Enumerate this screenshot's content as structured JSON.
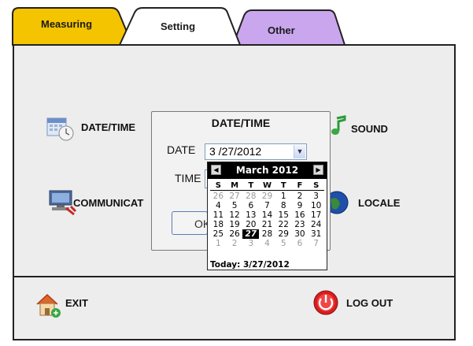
{
  "tabs": [
    {
      "label": "Measuring",
      "color": "#f4c400"
    },
    {
      "label": "Setting",
      "color": "#ffffff"
    },
    {
      "label": "Other",
      "color": "#c9a6ee"
    }
  ],
  "menu": {
    "date_time": "DATE/TIME",
    "sound": "SOUND",
    "communication": "COMMUNICAT",
    "locale": "LOCALE"
  },
  "footer": {
    "exit": "EXIT",
    "logout": "LOG OUT"
  },
  "dialog": {
    "title": "DATE/TIME",
    "date_label": "DATE",
    "date_value": "3 /27/2012",
    "time_label": "TIME",
    "ok_label": "OK"
  },
  "calendar": {
    "month": "March 2012",
    "weekdays": [
      "S",
      "M",
      "T",
      "W",
      "T",
      "F",
      "S"
    ],
    "weeks": [
      [
        {
          "d": "26",
          "m": true
        },
        {
          "d": "27",
          "m": true
        },
        {
          "d": "28",
          "m": true
        },
        {
          "d": "29",
          "m": true
        },
        {
          "d": "1"
        },
        {
          "d": "2"
        },
        {
          "d": "3"
        }
      ],
      [
        {
          "d": "4"
        },
        {
          "d": "5"
        },
        {
          "d": "6"
        },
        {
          "d": "7"
        },
        {
          "d": "8"
        },
        {
          "d": "9"
        },
        {
          "d": "10"
        }
      ],
      [
        {
          "d": "11"
        },
        {
          "d": "12"
        },
        {
          "d": "13"
        },
        {
          "d": "14"
        },
        {
          "d": "15"
        },
        {
          "d": "16"
        },
        {
          "d": "17"
        }
      ],
      [
        {
          "d": "18"
        },
        {
          "d": "19"
        },
        {
          "d": "20"
        },
        {
          "d": "21"
        },
        {
          "d": "22"
        },
        {
          "d": "23"
        },
        {
          "d": "24"
        }
      ],
      [
        {
          "d": "25"
        },
        {
          "d": "26"
        },
        {
          "d": "27",
          "s": true
        },
        {
          "d": "28"
        },
        {
          "d": "29"
        },
        {
          "d": "30"
        },
        {
          "d": "31"
        }
      ],
      [
        {
          "d": "1",
          "m": true
        },
        {
          "d": "2",
          "m": true
        },
        {
          "d": "3",
          "m": true
        },
        {
          "d": "4",
          "m": true
        },
        {
          "d": "5",
          "m": true
        },
        {
          "d": "6",
          "m": true
        },
        {
          "d": "7",
          "m": true
        }
      ]
    ],
    "today": "Today: 3/27/2012"
  },
  "icons": {
    "date_time": "calendar-clock-icon",
    "sound": "music-note-icon",
    "communication": "computer-network-icon",
    "locale": "globe-icon",
    "exit": "house-icon",
    "logout": "power-icon"
  },
  "colors": {
    "frame_bg": "#ededed",
    "power_red": "#d81e1e"
  }
}
